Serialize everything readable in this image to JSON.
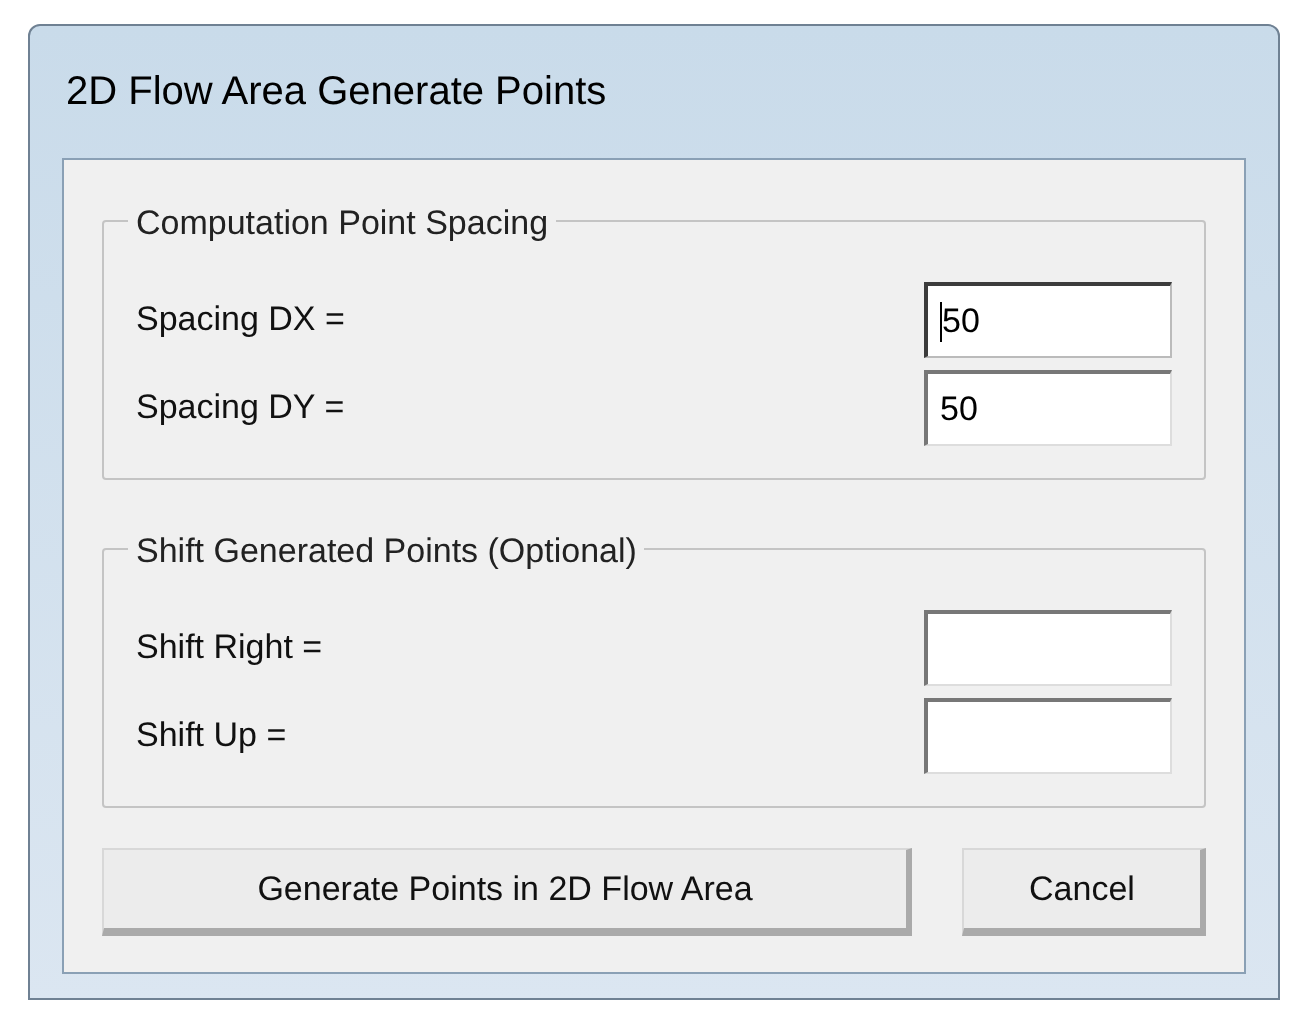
{
  "window": {
    "title": "2D Flow Area Generate Points"
  },
  "groups": [
    {
      "legend": "Computation Point Spacing",
      "fields": [
        {
          "label": "Spacing DX =",
          "value": "50",
          "focused": true
        },
        {
          "label": "Spacing DY =",
          "value": "50",
          "focused": false
        }
      ]
    },
    {
      "legend": "Shift Generated Points (Optional)",
      "fields": [
        {
          "label": "Shift Right =",
          "focused": false
        },
        {
          "label": "Shift Up =",
          "focused": false
        }
      ]
    }
  ],
  "buttons": [
    "Generate Points in 2D Flow Area",
    "Cancel"
  ]
}
